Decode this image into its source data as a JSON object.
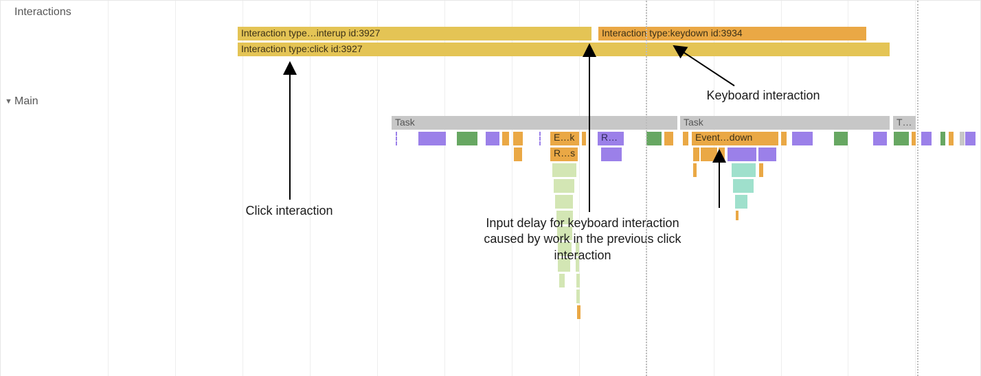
{
  "tracks": {
    "interactions_label": "Interactions",
    "main_label": "Main"
  },
  "interactions": {
    "bar1_label": "Interaction type…interup id:3927",
    "bar2_label": "Interaction type:click id:3927",
    "bar3_label": "Interaction type:keydown id:3934"
  },
  "main": {
    "task1_label": "Task",
    "task2_label": "Task",
    "task3_label": "T…",
    "event_ek": "E…k",
    "event_rs": "R…s",
    "event_r": "R…",
    "event_down": "Event…down"
  },
  "annotations": {
    "click": "Click interaction",
    "keyboard": "Keyboard interaction",
    "delay": "Input delay for keyboard interaction caused by work in the previous click interaction"
  },
  "gridlines_x": [
    156,
    254,
    352,
    450,
    548,
    646,
    744,
    842,
    940,
    1038,
    1136,
    1233,
    1331
  ],
  "dotted_x": [
    939,
    1334
  ],
  "colors": {
    "bar_darkgold": "#e4c455",
    "bar_orange": "#eaa845",
    "task_gray": "#c7c7c7",
    "purple": "#9b80e9",
    "green": "#67a762",
    "pale_green": "#d3e6b4",
    "teal": "#9fe0cc"
  },
  "chart_data": {
    "type": "bar",
    "title": "",
    "xlabel": "",
    "ylabel": "",
    "series": [
      {
        "track": "Interactions",
        "name": "pointerup id:3927",
        "start": 345,
        "end": 860,
        "row": 0,
        "color": "darkgold"
      },
      {
        "track": "Interactions",
        "name": "click id:3927",
        "start": 345,
        "end": 1294,
        "row": 1,
        "color": "darkgold"
      },
      {
        "track": "Interactions",
        "name": "keydown id:3934",
        "start": 870,
        "end": 1260,
        "row": 0,
        "color": "orange"
      },
      {
        "track": "Main",
        "name": "Task",
        "start": 569,
        "end": 985,
        "row": 0,
        "color": "gray"
      },
      {
        "track": "Main",
        "name": "Task",
        "start": 989,
        "end": 1294,
        "row": 0,
        "color": "gray"
      },
      {
        "track": "Main",
        "name": "Task",
        "start": 1299,
        "end": 1332,
        "row": 0,
        "color": "gray"
      }
    ]
  }
}
